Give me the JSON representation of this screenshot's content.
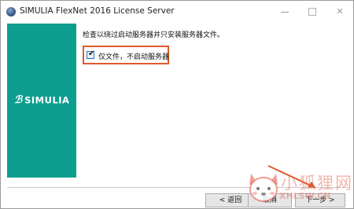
{
  "window": {
    "title": "SIMULIA FlexNet 2016 License Server"
  },
  "side_panel": {
    "brand_mark": "ℬ",
    "brand_name": "SIMULIA",
    "color": "#0e9e90"
  },
  "content": {
    "instruction": "检查以绕过启动服务器并只安装服务器文件。",
    "option": {
      "label": "仅文件，不启动服务器",
      "checked": true,
      "check_glyph": "✔"
    },
    "highlight_color": "#e05a2b"
  },
  "buttons": {
    "back": "< 返回",
    "cancel": "取消",
    "next": "下一步 >"
  },
  "watermark": {
    "text": "小狐狸网",
    "domain": "XHLSW.CN"
  }
}
